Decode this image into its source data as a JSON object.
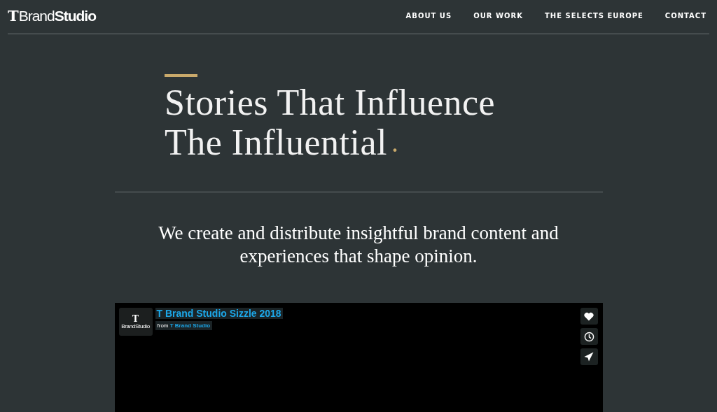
{
  "logo": {
    "mark": "T",
    "light": "Brand",
    "bold": "Studio"
  },
  "nav": [
    {
      "label": "ABOUT US"
    },
    {
      "label": "OUR WORK"
    },
    {
      "label": "THE SELECTS EUROPE"
    },
    {
      "label": "CONTACT"
    }
  ],
  "headline": {
    "lines": [
      "Stories That Influence",
      "The Influential"
    ],
    "accent": "."
  },
  "intro": "We create and distribute insightful brand content and experiences that shape opinion.",
  "video": {
    "title": "T Brand Studio Sizzle 2018",
    "byline_prefix": "from",
    "byline_author": "T Brand Studio",
    "avatar": {
      "mark": "T",
      "label": "BrandStudio"
    }
  }
}
